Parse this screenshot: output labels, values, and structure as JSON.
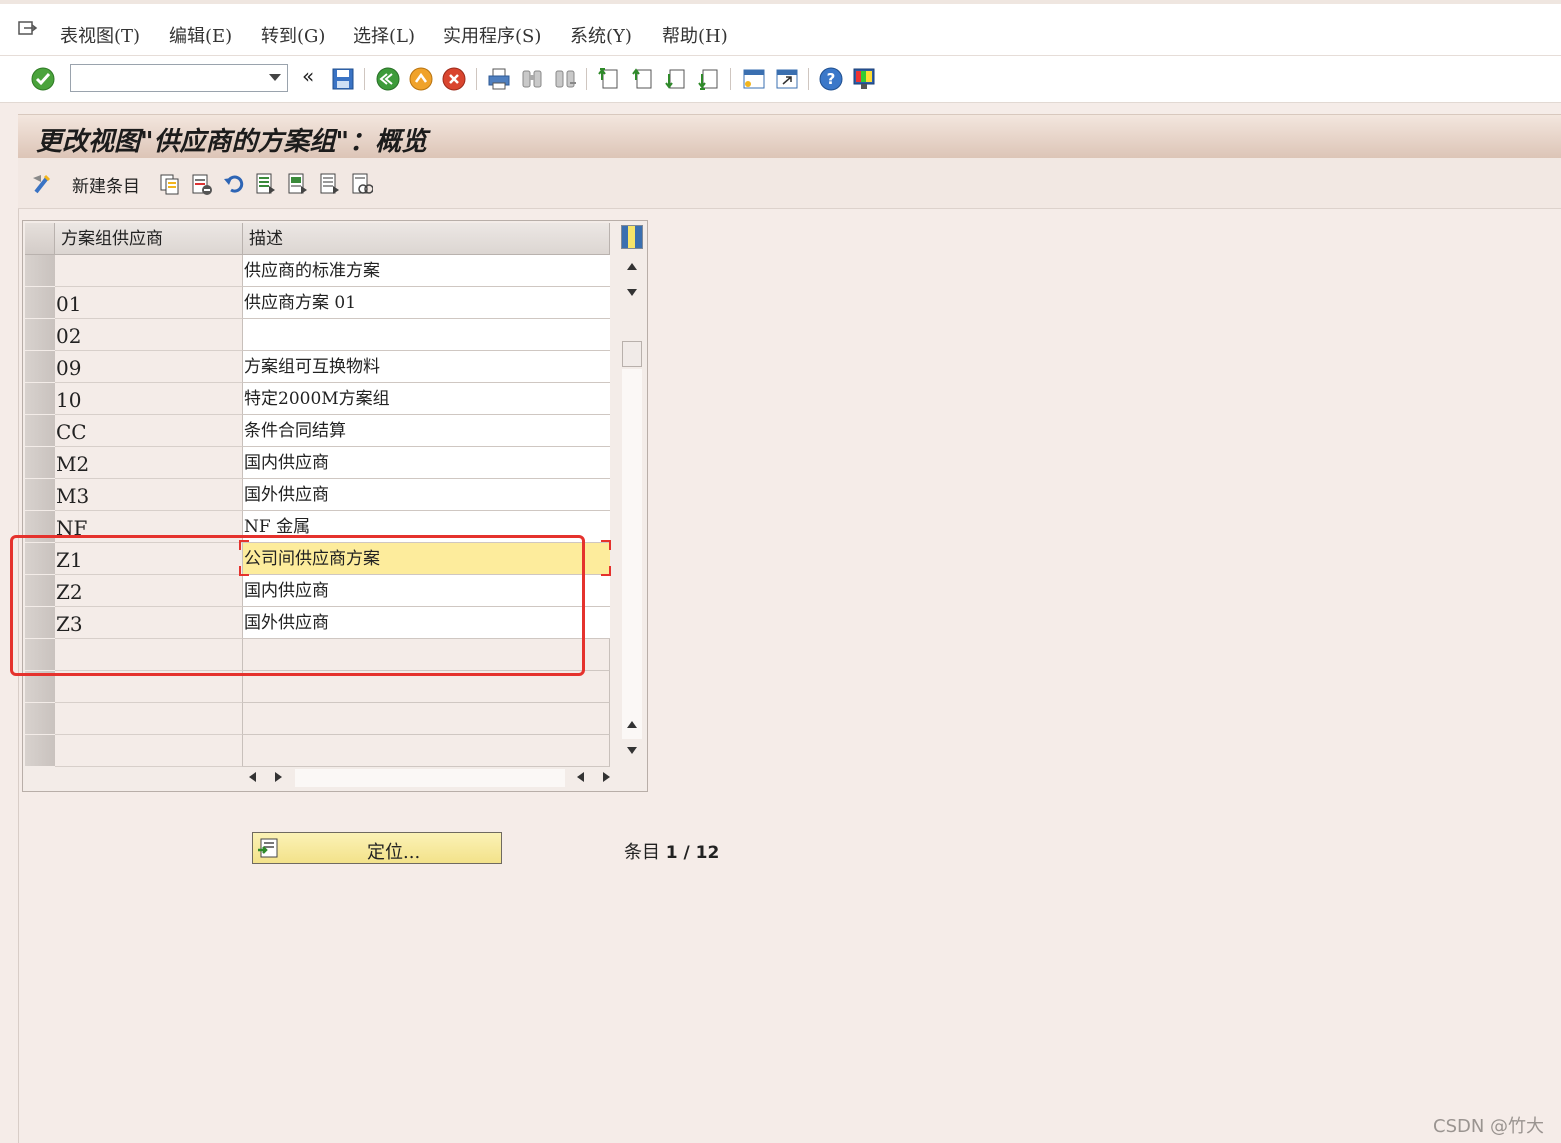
{
  "menu": {
    "items": [
      "表视图(T)",
      "编辑(E)",
      "转到(G)",
      "选择(L)",
      "实用程序(S)",
      "系统(Y)",
      "帮助(H)"
    ]
  },
  "toolbar": {
    "command_value": "",
    "back_label": "«"
  },
  "title": "更改视图\"供应商的方案组\"：概览",
  "app_toolbar": {
    "new_entry_label": "新建条目"
  },
  "table": {
    "columns": [
      "方案组供应商",
      "描述"
    ],
    "rows": [
      {
        "code": "",
        "desc": "供应商的标准方案"
      },
      {
        "code": "01",
        "desc": "供应商方案 01"
      },
      {
        "code": "02",
        "desc": ""
      },
      {
        "code": "09",
        "desc": "方案组可互换物料"
      },
      {
        "code": "10",
        "desc": "特定2000M方案组"
      },
      {
        "code": "CC",
        "desc": "条件合同结算"
      },
      {
        "code": "M2",
        "desc": "国内供应商"
      },
      {
        "code": "M3",
        "desc": "国外供应商"
      },
      {
        "code": "NF",
        "desc": "NF 金属"
      },
      {
        "code": "Z1",
        "desc": "公司间供应商方案"
      },
      {
        "code": "Z2",
        "desc": "国内供应商"
      },
      {
        "code": "Z3",
        "desc": "国外供应商"
      },
      {
        "code": "",
        "desc": ""
      },
      {
        "code": "",
        "desc": ""
      },
      {
        "code": "",
        "desc": ""
      },
      {
        "code": "",
        "desc": ""
      }
    ],
    "highlight_color": "#fdec9c"
  },
  "position_button_label": "定位...",
  "entries": {
    "label": "条目",
    "value": "1 / 12"
  },
  "watermark": "CSDN @竹大",
  "colors": {
    "annotation_red": "#e5322d",
    "title_band": "#dcc4b6"
  }
}
